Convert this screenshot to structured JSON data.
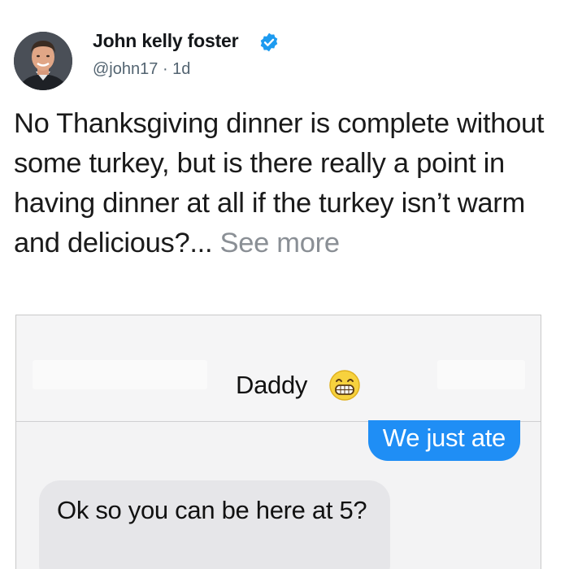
{
  "post": {
    "author_name": "John kelly foster",
    "verified_icon": "verified-badge-icon",
    "handle": "@john17",
    "separator": "·",
    "time": "1d",
    "text": "No Thanksgiving dinner is complete without some turkey, but is there really a point in having dinner at all if the turkey isn’t warm and delicious?...",
    "see_more_label": "See more"
  },
  "screenshot": {
    "contact_name": "Daddy",
    "contact_emoji": "grinning-face-emoji",
    "messages": [
      {
        "direction": "outgoing",
        "text": "We just ate"
      },
      {
        "direction": "incoming",
        "text": "Ok so you can be here at 5?"
      }
    ]
  },
  "colors": {
    "verified_blue": "#1d9bf0",
    "bubble_out": "#1f8ef5",
    "bubble_in": "#e6e6e9",
    "meta_gray": "#536471",
    "see_more_gray": "#8a8f95"
  }
}
